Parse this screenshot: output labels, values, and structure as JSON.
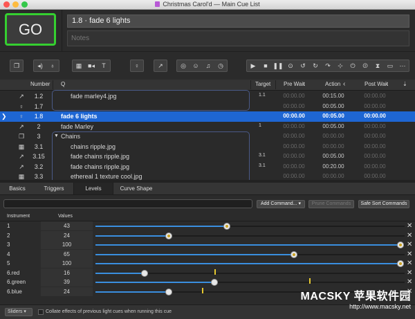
{
  "window": {
    "title": "Christmas Carol'd — Main Cue List",
    "doc_icon": "document-icon",
    "traffic_lights": {
      "close": "#fc5753",
      "minimize": "#fdbc40",
      "zoom": "#34c84a"
    }
  },
  "go_button": {
    "label": "GO",
    "accent": "#35d030"
  },
  "cue_name": "1.8 · fade 6 lights",
  "notes_placeholder": "Notes",
  "toolbar": {
    "groups": [
      [
        "group-icon"
      ],
      [
        "audio-icon",
        "mic-icon"
      ],
      [
        "video-icon",
        "camera-icon",
        "text-icon"
      ],
      [
        "light-icon"
      ],
      [
        "fade-icon"
      ],
      [
        "network-icon",
        "midi-icon",
        "music-icon",
        "timecode-icon"
      ],
      [
        "play-icon",
        "stop-icon",
        "pause-icon",
        "load-icon",
        "reset-icon",
        "devamp-icon",
        "goto-icon",
        "target-icon",
        "arm-icon",
        "disarm-icon",
        "wait-icon",
        "memo-icon",
        "script-icon"
      ]
    ]
  },
  "columns": {
    "number": "Number",
    "q": "Q",
    "target": "Target",
    "pre_wait": "Pre Wait",
    "action": "Action",
    "post_wait": "Post Wait"
  },
  "cues": [
    {
      "icon": "fade-icon",
      "number": "1.2",
      "name": "fade marley4.jpg",
      "target": "1.1",
      "pre": "00:00.00",
      "action": "00:15.00",
      "post": "00:00.00",
      "indent": 1
    },
    {
      "icon": "light-icon",
      "number": "1.7",
      "name": "",
      "target": "",
      "pre": "00:00.00",
      "action": "00:05.00",
      "post": "00:00.00",
      "indent": 1
    },
    {
      "icon": "light-icon",
      "number": "1.8",
      "name": "fade 6 lights",
      "target": "",
      "pre": "00:00.00",
      "action": "00:05.00",
      "post": "00:00.00",
      "indent": 0,
      "selected": true
    },
    {
      "icon": "fade-icon",
      "number": "2",
      "name": "fade Marley",
      "target": "1",
      "pre": "00:00.00",
      "action": "00:05.00",
      "post": "00:00.00",
      "indent": 0
    },
    {
      "icon": "group-icon",
      "number": "3",
      "name": "Chains",
      "target": "",
      "pre": "00:00.00",
      "action": "00:00.00",
      "post": "00:00.00",
      "indent": 0,
      "disclosure": "▼"
    },
    {
      "icon": "video-icon",
      "number": "3.1",
      "name": "chains ripple.jpg",
      "target": "",
      "pre": "00:00.00",
      "action": "00:00.00",
      "post": "00:00.00",
      "indent": 1
    },
    {
      "icon": "fade-icon",
      "number": "3.15",
      "name": "fade chains ripple.jpg",
      "target": "3.1",
      "pre": "00:00.00",
      "action": "00:05.00",
      "post": "00:00.00",
      "indent": 1
    },
    {
      "icon": "fade-icon",
      "number": "3.2",
      "name": "fade chains ripple.jpg",
      "target": "3.1",
      "pre": "00:00.00",
      "action": "00:20.00",
      "post": "00:00.00",
      "indent": 1
    },
    {
      "icon": "video-icon",
      "number": "3.3",
      "name": "ethereal 1 texture cool.jpg",
      "target": "",
      "pre": "00:00.00",
      "action": "00:00.00",
      "post": "00:00.00",
      "indent": 1
    }
  ],
  "tabs": [
    "Basics",
    "Triggers",
    "Levels",
    "Curve Shape"
  ],
  "active_tab": "Levels",
  "commands": {
    "add": "Add Command...",
    "prune": "Prune Commands",
    "safe_sort": "Safe Sort Commands"
  },
  "levels": {
    "headers": {
      "instrument": "Instrument",
      "values": "Values"
    },
    "rows": [
      {
        "instrument": "1",
        "value": "43",
        "level": 43
      },
      {
        "instrument": "2",
        "value": "24",
        "level": 24
      },
      {
        "instrument": "3",
        "value": "100",
        "level": 100
      },
      {
        "instrument": "4",
        "value": "65",
        "level": 65
      },
      {
        "instrument": "5",
        "value": "100",
        "level": 100
      },
      {
        "instrument": "6.red",
        "value": "16",
        "level": 16,
        "marker": 39
      },
      {
        "instrument": "6.green",
        "value": "39",
        "level": 39,
        "marker": 70
      },
      {
        "instrument": "6.blue",
        "value": "24",
        "level": 24,
        "marker": 35
      }
    ]
  },
  "footer": {
    "mode": "Sliders",
    "collate_label": "Collate effects of previous light cues when running this cue"
  },
  "watermark": {
    "line1": "MACSKY 苹果软件园",
    "line2": "http://www.macsky.net"
  },
  "colors": {
    "selection": "#1e66d3",
    "slider_fill": "#3a8fe0",
    "marker": "#e6c930"
  }
}
